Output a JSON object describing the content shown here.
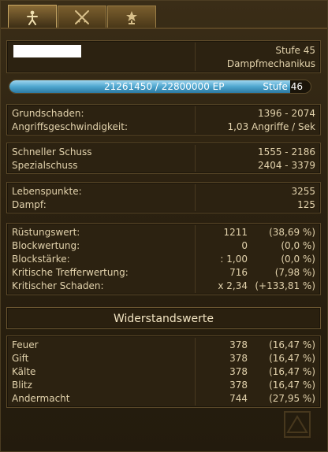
{
  "tabs": [
    {
      "name": "character-tab",
      "icon": "person-icon",
      "active": true
    },
    {
      "name": "combat-tab",
      "icon": "crossed-swords-icon",
      "active": false
    },
    {
      "name": "honor-tab",
      "icon": "trophy-icon",
      "active": false
    }
  ],
  "profile": {
    "level_label": "Stufe 45",
    "class_name": "Dampfmechanikus"
  },
  "experience": {
    "text": "21261450 / 22800000 EP",
    "next_level_label": "Stufe 46",
    "progress": 0.9325
  },
  "damage": [
    {
      "label": "Grundschaden:",
      "value": "1396 - 2074"
    },
    {
      "label": "Angriffsgeschwindigkeit:",
      "value": "1,03 Angriffe / Sek"
    }
  ],
  "skills": [
    {
      "label": "Schneller Schuss",
      "value": "1555 - 2186"
    },
    {
      "label": "Spezialschuss",
      "value": "2404 - 3379"
    }
  ],
  "vitals": [
    {
      "label": "Lebenspunkte:",
      "value": "3255"
    },
    {
      "label": "Dampf:",
      "value": "125"
    }
  ],
  "defense": [
    {
      "label": "Rüstungswert:",
      "value": "1211",
      "pct": "(38,69 %)"
    },
    {
      "label": "Blockwertung:",
      "value": "0",
      "pct": "(0,0 %)"
    },
    {
      "label": "Blockstärke:",
      "value": ": 1,00",
      "pct": "(0,0 %)"
    },
    {
      "label": "Kritische Trefferwertung:",
      "value": "716",
      "pct": "(7,98 %)"
    },
    {
      "label": "Kritischer Schaden:",
      "value": "x 2,34",
      "pct": "(+133,81 %)"
    }
  ],
  "resistances": {
    "title": "Widerstandswerte",
    "items": [
      {
        "label": "Feuer",
        "value": "378",
        "pct": "(16,47 %)"
      },
      {
        "label": "Gift",
        "value": "378",
        "pct": "(16,47 %)"
      },
      {
        "label": "Kälte",
        "value": "378",
        "pct": "(16,47 %)"
      },
      {
        "label": "Blitz",
        "value": "378",
        "pct": "(16,47 %)"
      },
      {
        "label": "Andermacht",
        "value": "744",
        "pct": "(27,95 %)"
      }
    ]
  },
  "colors": {
    "accent_gold": "#c9a864",
    "xp_blue": "#4ea6cf",
    "text": "#e2d2ac"
  }
}
